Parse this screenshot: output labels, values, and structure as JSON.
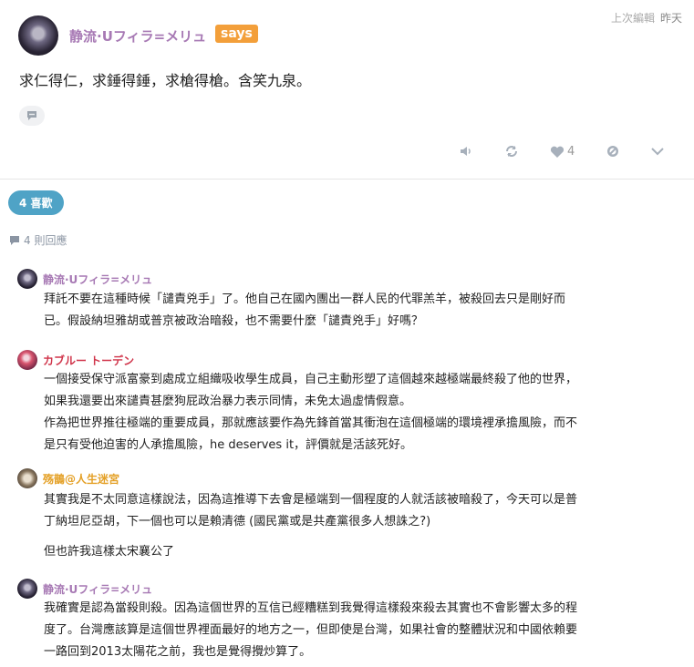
{
  "post": {
    "author": "静流·Uフィラ=メリュ",
    "says_label": "says",
    "edited_label": "上次編輯",
    "time": "昨天",
    "body": "求仁得仁，求錘得錘，求槍得槍。含笑九泉。",
    "like_count": "4"
  },
  "likes_summary": "4 喜歡",
  "replies_summary": "4 則回應",
  "replies": [
    {
      "author": "静流·Uフィラ=メリュ",
      "color": "#a779b4",
      "lines": [
        "拜託不要在這種時候「譴責兇手」了。他自己在國內團出一群人民的代罪羔羊，被殺回去只是剛好而",
        "已。假設納坦雅胡或普京被政治暗殺，也不需要什麼「譴責兇手」好嗎？"
      ]
    },
    {
      "author": "カブルー トーデン",
      "color": "#d0344a",
      "lines": [
        "一個接受保守派富豪到處成立組織吸收學生成員，自己主動形塑了這個越來越極端最終殺了他的世界，",
        "如果我還要出來譴責甚麼狗屁政治暴力表示同情，未免太過虛情假意。",
        "作為把世界推往極端的重要成員，那就應該要作為先鋒首當其衝泡在這個極端的環境裡承擔風險，而不",
        "是只有受他迫害的人承擔風險，he deserves it，評價就是活該死好。"
      ]
    },
    {
      "author": "殇鵲@人生迷宮",
      "color": "#e4a026",
      "lines": [
        "其實我是不太同意這樣說法，因為這推導下去會是極端到一個程度的人就活該被暗殺了，今天可以是普",
        "丁納坦尼亞胡，下一個也可以是賴清德 (國民黨或是共產黨很多人想誅之?)",
        "但也許我這樣太宋襄公了"
      ]
    },
    {
      "author": "静流·Uフィラ=メリュ",
      "color": "#a779b4",
      "lines": [
        "我確實是認為當殺則殺。因為這個世界的互信已經糟糕到我覺得這樣殺來殺去其實也不會影響太多的程",
        "度了。台灣應該算是這個世界裡面最好的地方之一，但即使是台灣，如果社會的整體狀況和中國依賴要",
        "一路回到2013太陽花之前，我也是覺得攪炒算了。"
      ]
    }
  ]
}
